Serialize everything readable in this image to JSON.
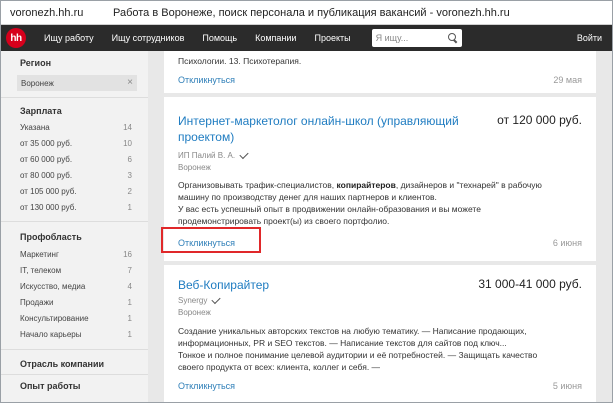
{
  "browser": {
    "domain": "voronezh.hh.ru",
    "title": "Работа в Воронеже, поиск персонала и публикация вакансий - voronezh.hh.ru"
  },
  "nav": {
    "logo": "hh",
    "items": [
      "Ищу работу",
      "Ищу сотрудников",
      "Помощь",
      "Компании",
      "Проекты"
    ],
    "search_placeholder": "Я ищу...",
    "login": "Войти"
  },
  "sidebar": {
    "region": {
      "heading": "Регион",
      "selected": "Воронеж"
    },
    "salary": {
      "heading": "Зарплата",
      "items": [
        {
          "label": "Указана",
          "count": "14"
        },
        {
          "label": "от 35 000 руб.",
          "count": "10"
        },
        {
          "label": "от 60 000 руб.",
          "count": "6"
        },
        {
          "label": "от 80 000 руб.",
          "count": "3"
        },
        {
          "label": "от 105 000 руб.",
          "count": "2"
        },
        {
          "label": "от 130 000 руб.",
          "count": "1"
        }
      ]
    },
    "field": {
      "heading": "Профобласть",
      "items": [
        {
          "label": "Маркетинг",
          "count": "16"
        },
        {
          "label": "IT, телеком",
          "count": "7"
        },
        {
          "label": "Искусство, медиа",
          "count": "4"
        },
        {
          "label": "Продажи",
          "count": "1"
        },
        {
          "label": "Консультирование",
          "count": "1"
        },
        {
          "label": "Начало карьеры",
          "count": "1"
        }
      ]
    },
    "industry_heading": "Отрасль компании",
    "experience_heading": "Опыт работы"
  },
  "vacancies": {
    "top": {
      "snippet_tail": "Психологии. 13. Психотерапия.",
      "respond": "Откликнуться",
      "date": "29 мая"
    },
    "mid": {
      "title_line1": "Интернет-маркетолог онлайн-школ (управляющий",
      "title_line2": "проектом)",
      "salary": "от 120 000 руб.",
      "company": "ИП Палий В. А.",
      "city": "Воронеж",
      "desc1a": "Организовывать трафик-специалистов, ",
      "desc1b": "копирайтеров",
      "desc1c": ", дизайнеров и \"технарей\" в рабочую",
      "desc2": "машину по производству денег для наших партнеров и клиентов.",
      "desc3": "У вас есть успешный опыт в продвижении онлайн-образования и вы можете",
      "desc4": "продемонстрировать проект(ы) из своего портфолио.",
      "respond": "Откликнуться",
      "date": "6 июня"
    },
    "bot": {
      "title": "Веб-Копирайтер",
      "salary": "31 000-41 000 руб.",
      "company": "Synergy",
      "city": "Воронеж",
      "desc1": "Создание уникальных авторских текстов на любую тематику. — Написание продающих,",
      "desc2": "информационных, PR и SEO текстов. — Написание текстов для сайтов под ключ...",
      "desc3": "Тонкое и полное понимание целевой аудитории и её потребностей. — Защищать качество",
      "desc4": "своего продукта от всех: клиента, коллег и себя. —",
      "respond": "Откликнуться",
      "date": "5 июня"
    }
  },
  "colors": {
    "nav_bg": "#2b2b2b",
    "logo_red": "#d6001c",
    "link_blue": "#2f7fb8",
    "highlight_red": "#e0282a"
  }
}
